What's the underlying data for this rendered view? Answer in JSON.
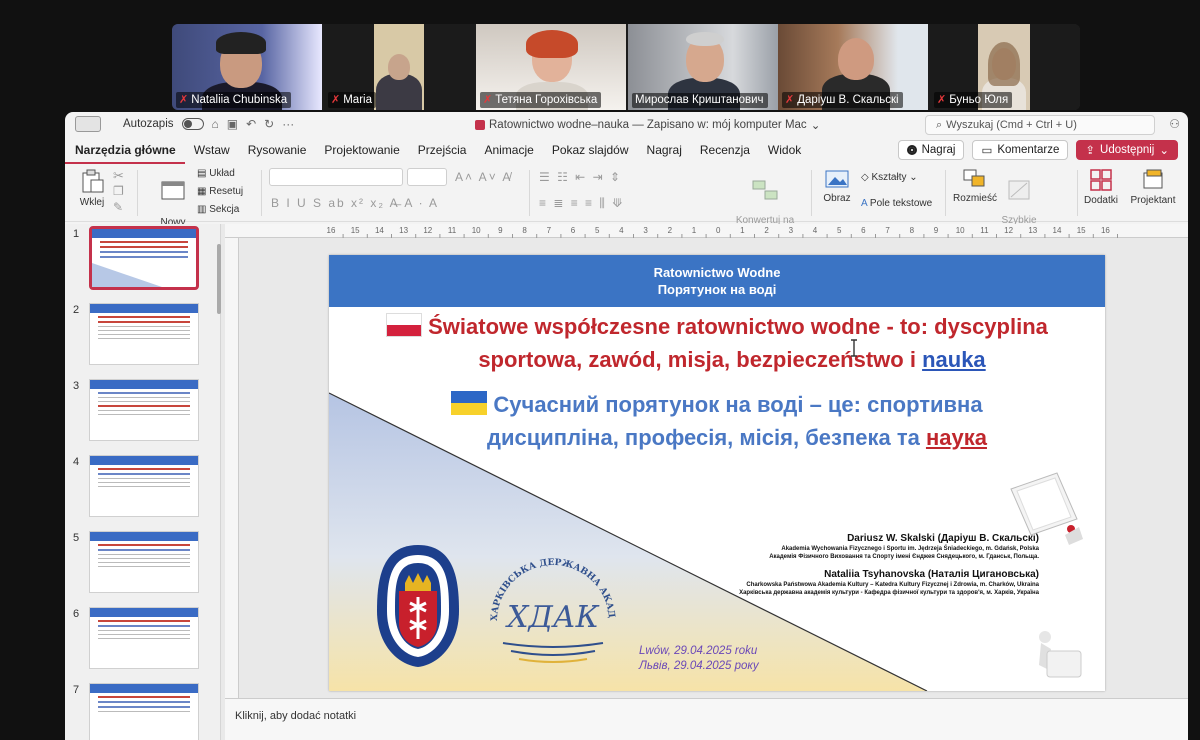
{
  "participants": [
    {
      "name": "Nataliia Chubinska",
      "muted": true,
      "active": false
    },
    {
      "name": "Maria",
      "muted": true,
      "active": false
    },
    {
      "name": "Тетяна Горохівська",
      "muted": true,
      "active": false
    },
    {
      "name": "Мирослав Криштанович",
      "muted": false,
      "active": false
    },
    {
      "name": "Даріуш В. Скальскі",
      "muted": true,
      "active": true
    },
    {
      "name": "Буньо Юля",
      "muted": true,
      "active": false
    }
  ],
  "titlebar": {
    "autosave": "Autozapis",
    "document_title": "Ratownictwo wodne–nauka — Zapisano w: mój komputer Mac",
    "search_placeholder": "Wyszukaj (Cmd + Ctrl + U)"
  },
  "tabs": [
    "Narzędzia główne",
    "Wstaw",
    "Rysowanie",
    "Projektowanie",
    "Przejścia",
    "Animacje",
    "Pokaz slajdów",
    "Nagraj",
    "Recenzja",
    "Widok"
  ],
  "tab_actions": {
    "record": "Nagraj",
    "comments": "Komentarze",
    "share": "Udostępnij"
  },
  "ribbon": {
    "paste": "Wklej",
    "new_slide": "Nowy\nslajd",
    "layout": "Układ",
    "reset": "Resetuj",
    "section": "Sekcja",
    "smartart": "Konwertuj na\ngrafikę SmartArt",
    "picture": "Obraz",
    "shapes": "Kształty",
    "textbox": "Pole tekstowe",
    "arrange": "Rozmieść",
    "quick_styles": "Szybkie\nstyle",
    "addins": "Dodatki",
    "designer": "Projektant"
  },
  "thumbnails": [
    "1",
    "2",
    "3",
    "4",
    "5",
    "6",
    "7"
  ],
  "ruler_numbers": [
    "16",
    "15",
    "14",
    "13",
    "12",
    "11",
    "10",
    "9",
    "8",
    "7",
    "6",
    "5",
    "4",
    "3",
    "2",
    "1",
    "0",
    "1",
    "2",
    "3",
    "4",
    "5",
    "6",
    "7",
    "8",
    "9",
    "10",
    "11",
    "12",
    "13",
    "14",
    "15",
    "16"
  ],
  "slide": {
    "header_line1": "Ratownictwo Wodne",
    "header_line2": "Порятунок на воді",
    "pl_line1": "Światowe współczesne ratownictwo wodne - to: dyscyplina",
    "pl_line2_a": "sportowa, zawód, misja, bezpieczeństwo i ",
    "pl_line2_b": "nauka",
    "ua_line1": "Сучасний порятунок на воді – це: спортивна",
    "ua_line2_a": "дисципліна, професія, місія, безпека та ",
    "ua_line2_b": "наука",
    "author1": "Dariusz W. Skalski (Даріуш В. Скальскі)",
    "author1_aff1": "Akademia Wychowania Fizycznego i Sportu im. Jędrzeja Śniadeckiego, m. Gdańsk, Polska",
    "author1_aff2": "Академія Фізичного Виховання та Спорту імені Єнджея Снядецького, м. Гданськ, Польща.",
    "author2": "Nataliia Tsyhanovska (Наталія Циганoвська)",
    "author2_aff1": "Charkowska Państwowa Akademia Kultury – Katedra Kultury Fizycznej i Zdrowia, m. Charków, Ukraina",
    "author2_aff2": "Харківська державна академія культури - Кафедра фізичної культури та здоров'я, м. Харків, Україна",
    "date_pl": "Lwów, 29.04.2025 roku",
    "date_ua": "Львів, 29.04.2025 року",
    "logo2_text": "ХАРКІВСЬКА ДЕРЖАВНА АКАДЕМІЯ КУЛЬТУРИ",
    "logo2_mono": "ХДАК"
  },
  "notes_placeholder": "Kliknij, aby dodać notatki",
  "colors": {
    "accent": "#c4314b",
    "slide_header": "#3b74c4",
    "active_speaker": "#3ad16f"
  }
}
